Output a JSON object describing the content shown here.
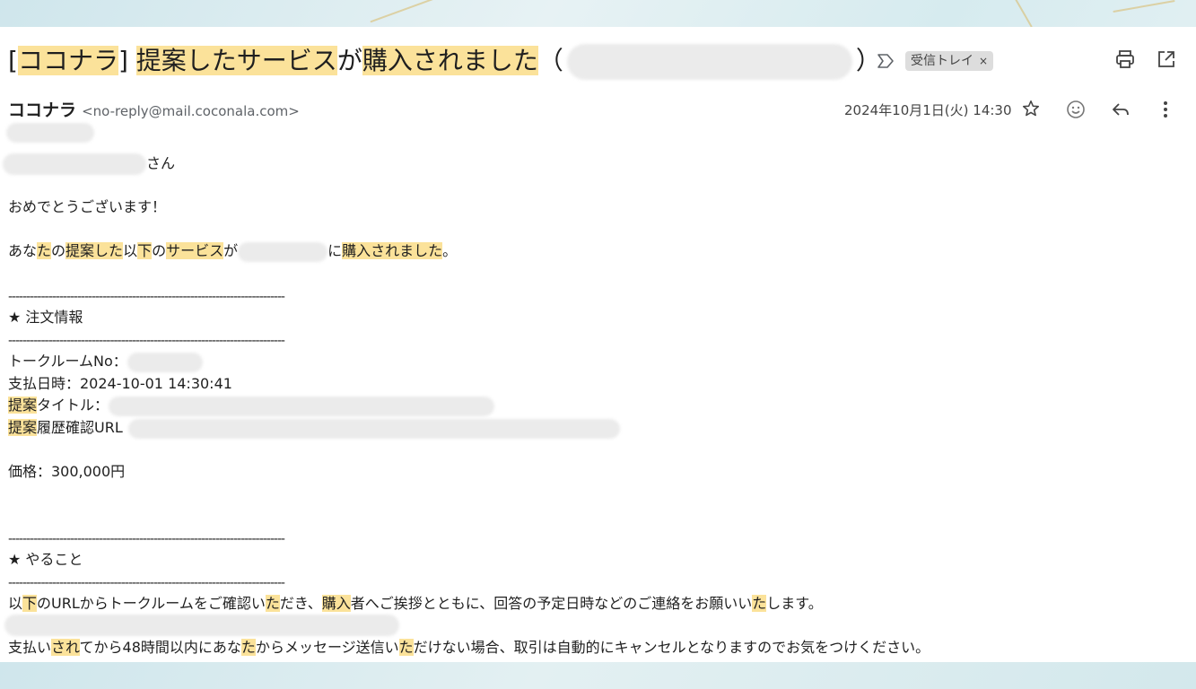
{
  "subject": {
    "bracket_open": "[",
    "service_name": "ココナラ",
    "bracket_close": "]",
    "part1": "提案したサービス",
    "part2": "が",
    "part3": "購入されました",
    "paren_open": "（",
    "paren_close": "）"
  },
  "labels": {
    "inbox": "受信トレイ",
    "remove": "×"
  },
  "sender": {
    "name": "ココナラ",
    "email": "<no-reply@mail.coconala.com>"
  },
  "date": "2024年10月1日(火) 14:30",
  "icons": {
    "label": "important-label-icon",
    "print": "print-icon",
    "open_new": "open-in-new-window-icon",
    "star": "star-icon",
    "emoji": "emoji-reaction-icon",
    "reply": "reply-icon",
    "more": "more-vert-icon"
  },
  "body": {
    "salutation_suffix": "さん",
    "congrats": "おめでとうございます！",
    "notice": {
      "a": "あな",
      "b": "た",
      "c": "の",
      "d": "提案した",
      "e": "以",
      "f": "下",
      "g": "の",
      "h": "サービス",
      "i": "が",
      "j": "に",
      "k": "購入されました",
      "l": "。"
    },
    "divider": "----------------------------------------------------------------------------",
    "order_heading": "★ 注文情報",
    "talkroom_label": "トークルームNo：",
    "paid_at": "支払日時：2024-10-01 14:30:41",
    "title_hl": "提案",
    "title_rest": "タイトル：",
    "history_hl": "提案",
    "history_rest": "履歴確認URL",
    "price": "価格：300,000円",
    "todo_heading": "★ やること",
    "todo": {
      "a": "以",
      "b": "下",
      "c": "のURLからトークルームをご確認い",
      "d": "た",
      "e": "だき、",
      "f": "購入",
      "g": "者へご挨拶とともに、回答の予定日時などのご連絡をお願いい",
      "h": "た",
      "i": "します。"
    },
    "cancel": {
      "a": "支払い",
      "b": "され",
      "c": "てから48時間以内にあな",
      "d": "た",
      "e": "からメッセージ送信い",
      "f": "た",
      "g": "だけない場合、取引は自動的にキャンセルとなりますのでお気をつけください。"
    }
  }
}
